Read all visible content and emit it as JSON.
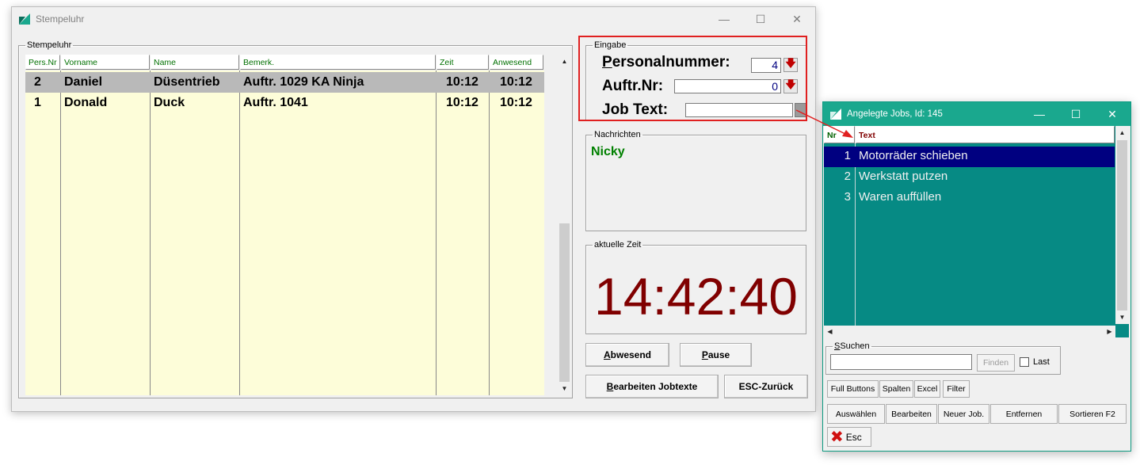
{
  "main_window": {
    "title": "Stempeluhr",
    "group_stempeluhr": "Stempeluhr",
    "columns": [
      "Pers.Nr",
      "Vorname",
      "Name",
      "Bemerk.",
      "Zeit",
      "Anwesend"
    ],
    "rows": [
      {
        "pers_nr": "2",
        "vorname": "Daniel",
        "name": "Düsentrieb",
        "bemerk": "Auftr.  1029 KA Ninja",
        "zeit": "10:12",
        "anwesend": "10:12"
      },
      {
        "pers_nr": "1",
        "vorname": "Donald",
        "name": "Duck",
        "bemerk": "Auftr.  1041",
        "zeit": "10:12",
        "anwesend": "10:12"
      }
    ],
    "eingabe": {
      "legend": "Eingabe",
      "personalnummer_label_u": "P",
      "personalnummer_label_rest": "ersonalnummer:",
      "personalnummer_value": "4",
      "auftr_label": "Auftr.Nr:",
      "auftr_value": "0",
      "jobtext_label": "Job Text:",
      "jobtext_value": ""
    },
    "nachrichten": {
      "legend": "Nachrichten",
      "text": "Nicky"
    },
    "zeit": {
      "legend": "aktuelle Zeit",
      "value": "14:42:40"
    },
    "buttons": {
      "abwesend_u": "A",
      "abwesend_rest": "bwesend",
      "pause_u": "P",
      "pause_rest": "ause",
      "bearbeiten_u": "B",
      "bearbeiten_rest": "earbeiten Jobtexte",
      "esc": "ESC-Zurück"
    }
  },
  "jobs_window": {
    "title": "Angelegte Jobs, Id: 145",
    "columns": [
      "Nr",
      "Text"
    ],
    "rows": [
      {
        "nr": "1",
        "text": "Motorräder schieben"
      },
      {
        "nr": "2",
        "text": "Werkstatt putzen"
      },
      {
        "nr": "3",
        "text": "Waren auffüllen"
      }
    ],
    "suchen": {
      "legend": "Suchen",
      "value": "",
      "finden": "Finden",
      "last": "Last"
    },
    "toolbar": [
      "Full Buttons",
      "Spalten",
      "Excel",
      "Filter"
    ],
    "actions": [
      "Auswählen",
      "Bearbeiten",
      "Neuer Job.",
      "Entfernen",
      "Sortieren F2"
    ],
    "esc": "Esc"
  },
  "colors": {
    "highlight_red": "#e02020",
    "grid_bg": "#fdfdd9",
    "selected_row": "#b9b9b9",
    "jobs_bg": "#068a84",
    "jobs_selected": "#000080",
    "clock": "#800000",
    "message": "#008000"
  }
}
